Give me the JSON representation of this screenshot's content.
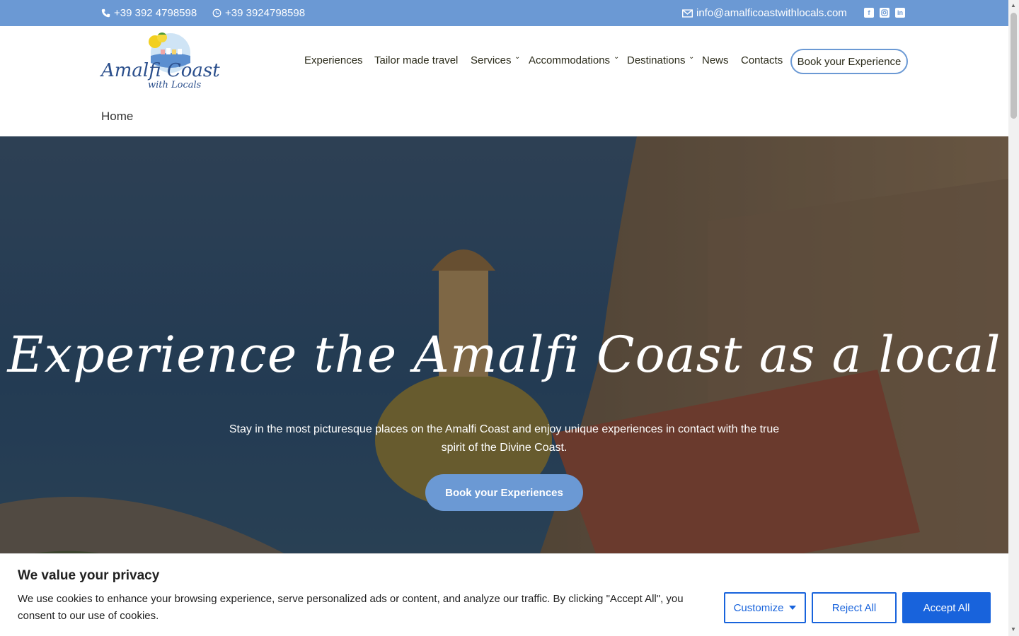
{
  "topbar": {
    "phone": "+39 392 4798598",
    "whatsapp": "+39 3924798598",
    "email": "info@amalficoastwithlocals.com",
    "social": [
      "facebook-icon",
      "instagram-icon",
      "linkedin-icon"
    ]
  },
  "logo": {
    "line1": "Amalfi Coast",
    "line2": "with Locals"
  },
  "nav": {
    "items": [
      {
        "label": "Experiences",
        "dropdown": false
      },
      {
        "label": "Tailor made travel",
        "dropdown": false
      },
      {
        "label": "Services",
        "dropdown": true
      },
      {
        "label": "Accommodations",
        "dropdown": true
      },
      {
        "label": "Destinations",
        "dropdown": true
      },
      {
        "label": "News",
        "dropdown": false
      },
      {
        "label": "Contacts",
        "dropdown": false
      }
    ],
    "cta": "Book your Experience"
  },
  "breadcrumb": "Home",
  "hero": {
    "title": "Experience the Amalfi Coast as a local",
    "subtitle": "Stay in the most picturesque places on the Amalfi Coast and enjoy unique experiences in contact with the true spirit of the Divine Coast.",
    "button": "Book your Experiences"
  },
  "cookie": {
    "title": "We value your privacy",
    "text": "We use cookies to enhance your browsing experience, serve personalized ads or content, and analyze our traffic. By clicking \"Accept All\", you consent to our use of cookies.",
    "customize": "Customize",
    "reject": "Reject All",
    "accept": "Accept All"
  },
  "colors": {
    "brand": "#6b99d4",
    "cookie_accent": "#1863dc"
  }
}
